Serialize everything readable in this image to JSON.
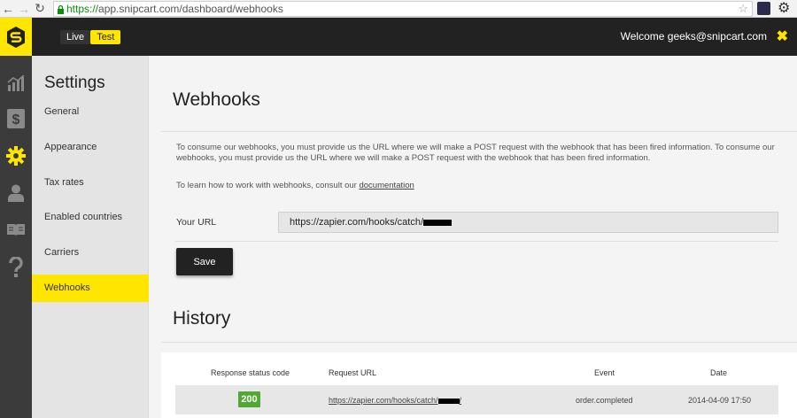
{
  "browser": {
    "url_scheme": "https://",
    "url_rest": "app.snipcart.com/dashboard/webhooks"
  },
  "header": {
    "env_live": "Live",
    "env_test": "Test",
    "welcome": "Welcome geeks@snipcart.com",
    "close_symbol": "✖",
    "accent_color": "#ffe600"
  },
  "rail": {
    "icons": [
      "chart-icon",
      "dollar-icon",
      "gear-icon",
      "user-icon",
      "book-icon",
      "help-icon"
    ],
    "active_icon": "gear-icon"
  },
  "settings": {
    "title": "Settings",
    "items": [
      "General",
      "Appearance",
      "Tax rates",
      "Enabled countries",
      "Carriers",
      "Webhooks"
    ],
    "active_item": "Webhooks"
  },
  "webhooks": {
    "title": "Webhooks",
    "description": "To consume our webhooks, you must provide us the URL where we will make a POST request with the webhook that has been fired information. To consume our webhooks, you must provide us the URL where we will make a POST request with the webhook that has been fired information.",
    "learn_prefix": "To learn how to work with webhooks, consult our ",
    "learn_link": "documentation",
    "url_label": "Your URL",
    "url_value": "https://zapier.com/hooks/catch/",
    "save_label": "Save"
  },
  "history": {
    "title": "History",
    "columns": [
      "Response status code",
      "Request URL",
      "Event",
      "Date"
    ],
    "rows": [
      {
        "status": "200",
        "request_url": "https://zapier.com/hooks/catch/",
        "request_url_suffix": "/",
        "event": "order.completed",
        "date": "2014-04-09 17:50",
        "status_color": "#52a832"
      }
    ]
  }
}
